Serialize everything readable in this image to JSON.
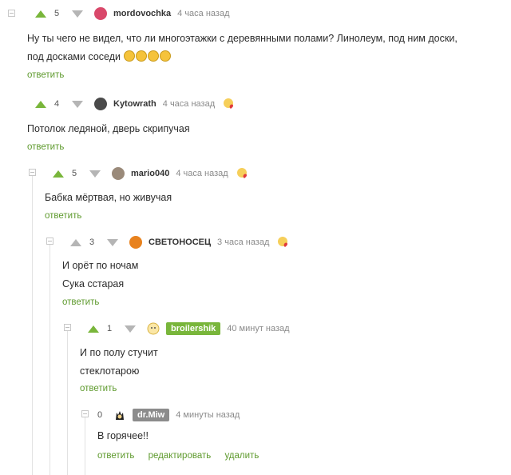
{
  "colors": {
    "accent_green": "#5e9a2d",
    "upvote": "#79b63b",
    "badge_green": "#79b63b",
    "badge_gray": "#8c8c8c"
  },
  "comments": [
    {
      "votes": "5",
      "author": "mordovochka",
      "time": "4 часа назад",
      "lines": [
        "Ну ты чего не видел, что ли многоэтажки с деревянными полами? Линолеум, под ним доски,",
        "под досками соседи"
      ],
      "emoji_count": 4,
      "actions": [
        "ответить"
      ]
    },
    {
      "votes": "4",
      "author": "Kytowrath",
      "time": "4 часа назад",
      "lines": [
        "Потолок ледяной, дверь скрипучая"
      ],
      "actions": [
        "ответить"
      ]
    },
    {
      "votes": "5",
      "author": "mario040",
      "time": "4 часа назад",
      "lines": [
        "Бабка мёртвая, но живучая"
      ],
      "actions": [
        "ответить"
      ]
    },
    {
      "votes": "3",
      "author": "СВЕТОНОСЕЦ",
      "time": "3 часа назад",
      "lines": [
        "И орёт по ночам",
        "Сука сстарая"
      ],
      "actions": [
        "ответить"
      ]
    },
    {
      "votes": "1",
      "author": "broilershik",
      "time": "40 минут назад",
      "lines": [
        "И по полу стучит",
        "стеклотарою"
      ],
      "actions": [
        "ответить"
      ]
    },
    {
      "votes": "0",
      "author": "dr.Miw",
      "time": "4 минуты назад",
      "lines": [
        "В горячее!!"
      ],
      "actions": [
        "ответить",
        "редактировать",
        "удалить"
      ]
    }
  ]
}
